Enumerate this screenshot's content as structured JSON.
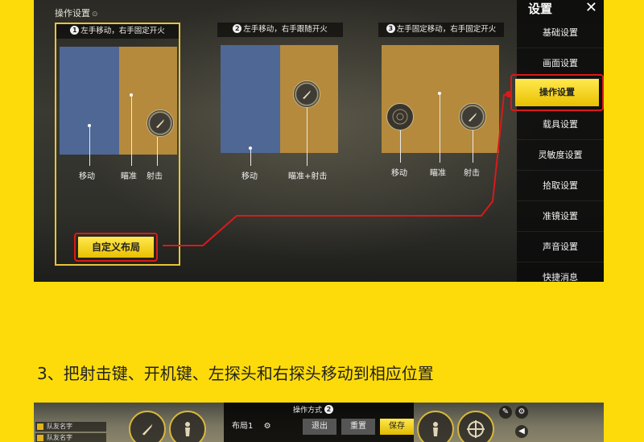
{
  "settings_panel": {
    "title": "操作设置",
    "options": [
      {
        "num": "1",
        "desc": "左手移动，右手固定开火",
        "labels": [
          "移动",
          "瞄准",
          "射击"
        ]
      },
      {
        "num": "2",
        "desc": "左手移动，右手跟随开火",
        "labels": [
          "移动",
          "瞄准+射击"
        ]
      },
      {
        "num": "3",
        "desc": "左手固定移动，右手固定开火",
        "labels": [
          "移动",
          "瞄准",
          "射击"
        ]
      }
    ],
    "custom_button": "自定义布局"
  },
  "menu": {
    "title": "设置",
    "close_icon": "close-icon",
    "items": [
      "基础设置",
      "画面设置",
      "操作设置",
      "载具设置",
      "灵敏度设置",
      "拾取设置",
      "准镜设置",
      "声音设置",
      "快捷消息"
    ],
    "active_index": 2
  },
  "step_text": "3、把射击键、开机键、左探头和右探头移动到相应位置",
  "editor": {
    "title": "操作方式",
    "title_badge": "2",
    "layout_name": "布局1",
    "buttons": {
      "exit": "退出",
      "reset": "重置",
      "save": "保存"
    },
    "team": [
      "队友名字",
      "队友名字"
    ]
  },
  "colors": {
    "accent": "#fddb0a",
    "highlight": "#d91a1a",
    "blue_zone": "#4f6795",
    "orange_zone": "#b58a3c"
  }
}
